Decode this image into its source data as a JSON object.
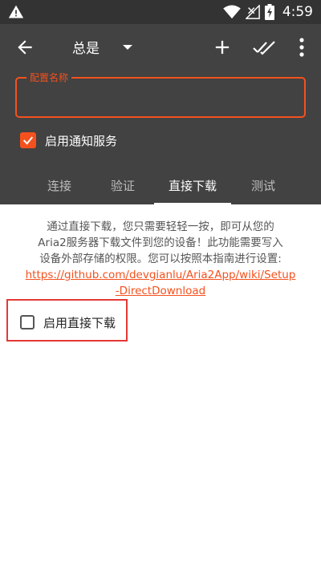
{
  "status_bar": {
    "time": "4:59",
    "icons": [
      "warning-icon",
      "wifi-icon",
      "no-signal-icon",
      "battery-charging-icon"
    ]
  },
  "toolbar": {
    "title": "总是",
    "icons": [
      "back-arrow-icon",
      "dropdown-icon",
      "add-icon",
      "done-all-icon",
      "more-vert-icon"
    ]
  },
  "config_name": {
    "label": "配置名称",
    "value": ""
  },
  "notification": {
    "label": "启用通知服务",
    "checked": true
  },
  "tabs": [
    {
      "label": "连接",
      "active": false
    },
    {
      "label": "验证",
      "active": false
    },
    {
      "label": "直接下载",
      "active": true
    },
    {
      "label": "测试",
      "active": false
    }
  ],
  "direct_download": {
    "description_lines": [
      "通过直接下载，您只需要轻轻一按，即可从您的",
      "Aria2服务器下载文件到您的设备！此功能需要写入",
      "设备外部存储的权限。您可以按照本指南进行设置:"
    ],
    "link_lines": [
      "https://github.com/devgianlu/Aria2App/wiki/Setup",
      "-DirectDownload"
    ],
    "enable_label": "启用直接下载",
    "enabled": false
  },
  "colors": {
    "accent": "#f4511e",
    "appbar": "#424242",
    "statusbar": "#333333",
    "highlight": "#e53935"
  }
}
